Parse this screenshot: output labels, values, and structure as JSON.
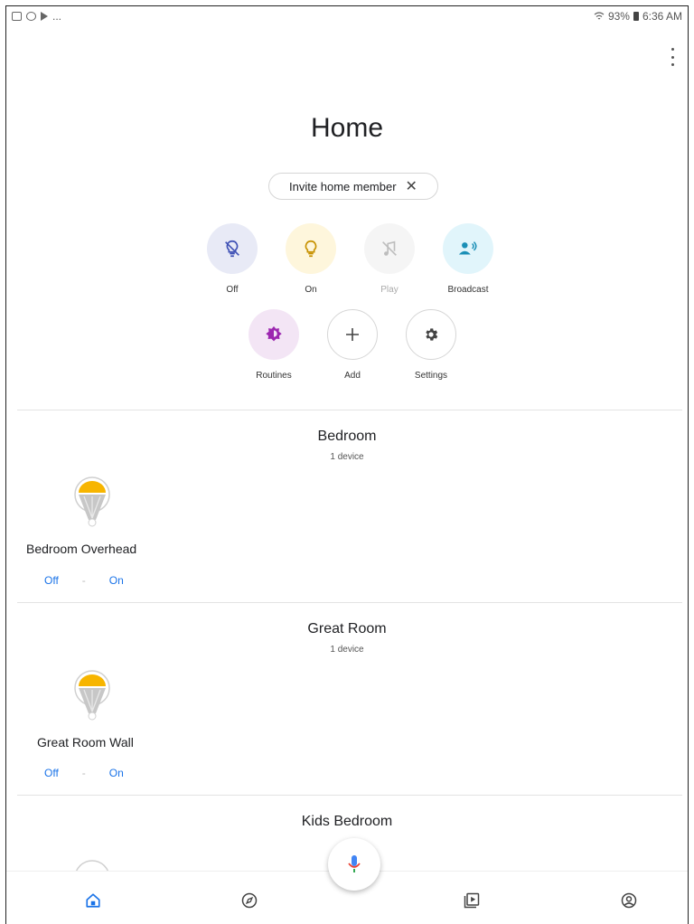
{
  "status_bar": {
    "left_extra": "...",
    "battery": "93%",
    "time": "6:36 AM"
  },
  "header": {
    "title": "Home",
    "invite_chip_label": "Invite home member",
    "invite_chip_close_icon": "close-icon",
    "menu_icon": "more-vert-icon"
  },
  "actions": [
    {
      "label": "Off",
      "icon": "light-off-icon",
      "bg": "#e8eaf6",
      "fg": "#3f51b5"
    },
    {
      "label": "On",
      "icon": "lightbulb-icon",
      "bg": "#fef6dc",
      "fg": "#c79100"
    },
    {
      "label": "Play",
      "icon": "music-off-icon",
      "bg": "#f5f5f5",
      "fg": "#bdbdbd"
    },
    {
      "label": "Broadcast",
      "icon": "broadcast-icon",
      "bg": "#e1f5fb",
      "fg": "#1a8fb6"
    },
    {
      "label": "Routines",
      "icon": "routines-icon",
      "bg": "#f3e5f5",
      "fg": "#9c27b0"
    },
    {
      "label": "Add",
      "icon": "add-icon",
      "bg": "#ffffff",
      "fg": "#444444"
    },
    {
      "label": "Settings",
      "icon": "gear-icon",
      "bg": "#ffffff",
      "fg": "#444444"
    }
  ],
  "rooms": [
    {
      "name": "Bedroom",
      "count": "1 device",
      "devices": [
        {
          "name": "Bedroom Overhead",
          "off": "Off",
          "sep": "-",
          "on": "On"
        }
      ]
    },
    {
      "name": "Great Room",
      "count": "1 device",
      "devices": [
        {
          "name": "Great Room Wall",
          "off": "Off",
          "sep": "-",
          "on": "On"
        }
      ]
    },
    {
      "name": "Kids Bedroom"
    }
  ],
  "fab": {
    "icon": "mic-icon"
  },
  "bottom_nav": [
    {
      "icon": "home-icon",
      "active": true
    },
    {
      "icon": "discover-icon"
    },
    {
      "icon": "media-icon"
    },
    {
      "icon": "account-icon"
    }
  ],
  "colors": {
    "accent": "#1a73e8",
    "bulb_yellow": "#f7b500"
  }
}
